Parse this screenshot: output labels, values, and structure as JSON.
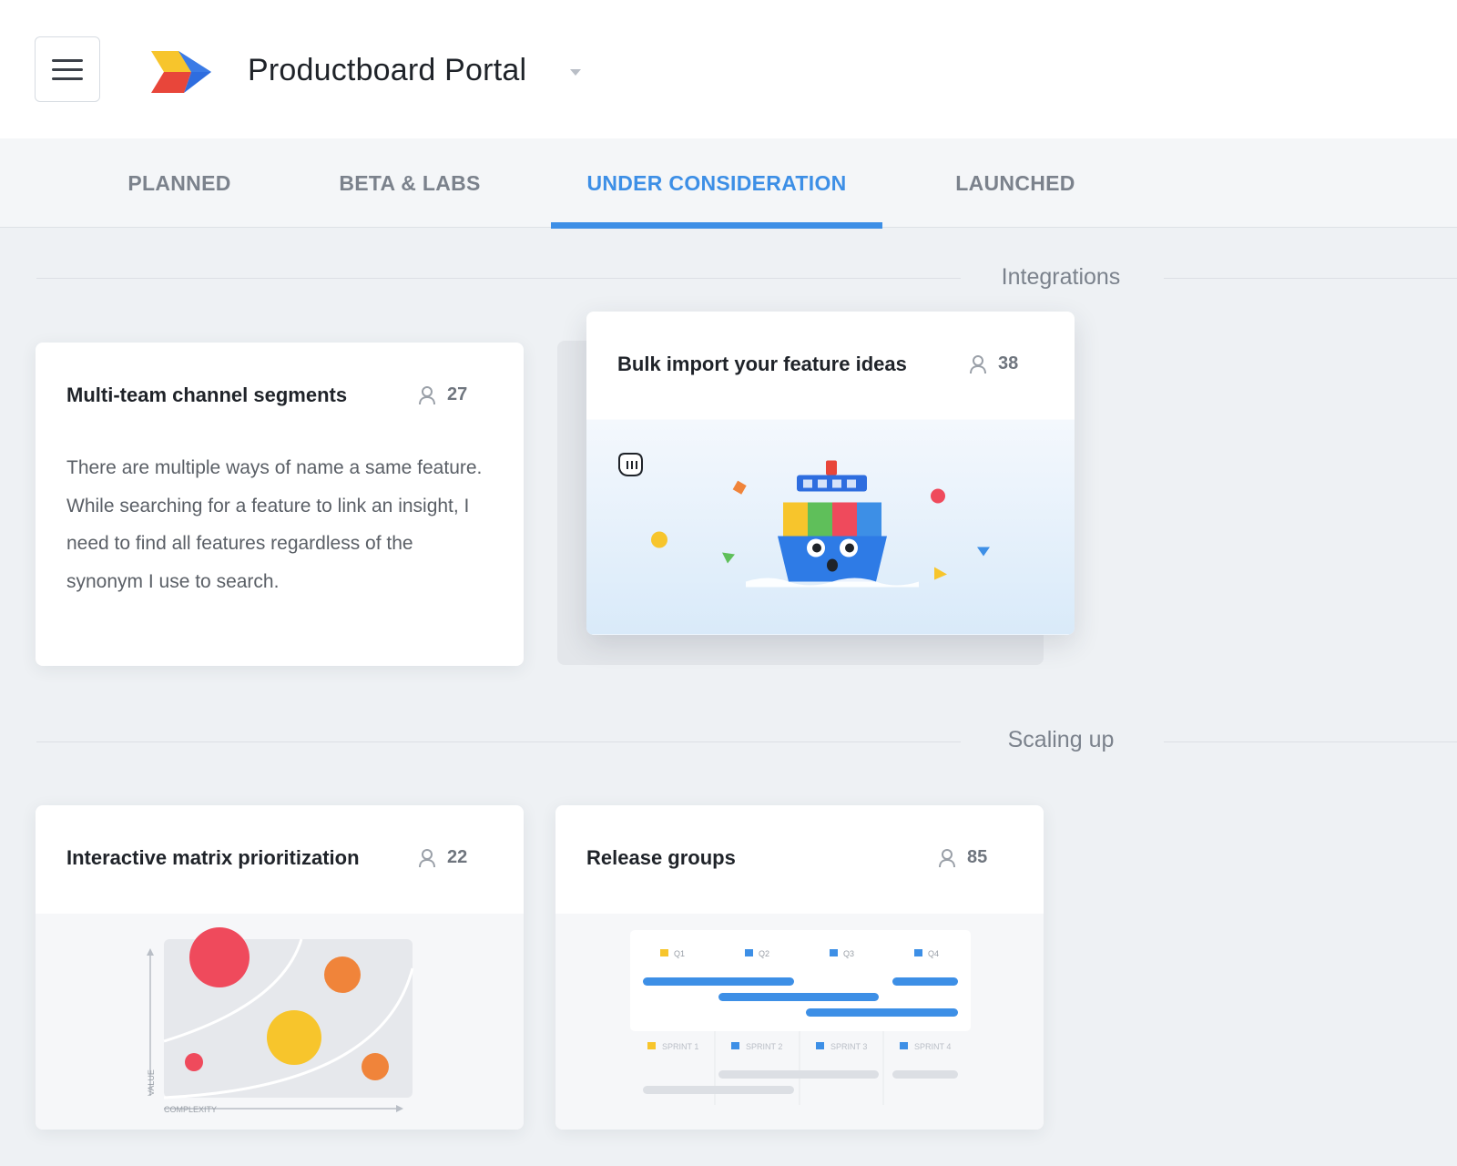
{
  "header": {
    "menu_icon": "hamburger-menu-icon",
    "logo_icon": "productboard-logo-icon",
    "portal_title": "Productboard Portal",
    "caret_icon": "caret-down-icon"
  },
  "tabs": [
    {
      "label": "PLANNED",
      "active": false
    },
    {
      "label": "BETA & LABS",
      "active": false
    },
    {
      "label": "UNDER CONSIDERATION",
      "active": true
    },
    {
      "label": "LAUNCHED",
      "active": false
    }
  ],
  "colors": {
    "accent": "#3d8fe6",
    "background": "#eef1f4",
    "card": "#ffffff"
  },
  "sections": [
    {
      "title": "Integrations",
      "cards": [
        {
          "title": "Multi-team channel segments",
          "votes": "27",
          "vote_icon": "user-icon",
          "description": "There are multiple ways of name a same feature. While searching for a feature to link an insight, I need to find all features regardless of the synonym I use to search."
        },
        {
          "title": "Bulk import your feature ideas",
          "votes": "38",
          "vote_icon": "user-icon",
          "illustration": "container-ship-illustration"
        }
      ]
    },
    {
      "title": "Scaling up",
      "cards": [
        {
          "title": "Interactive matrix prioritization",
          "votes": "22",
          "vote_icon": "user-icon",
          "illustration": {
            "type": "prioritization-matrix",
            "y_label": "VALUE",
            "x_label": "COMPLEXITY"
          }
        },
        {
          "title": "Release groups",
          "votes": "85",
          "vote_icon": "user-icon",
          "illustration": {
            "type": "release-roadmap",
            "quarters": [
              "Q1",
              "Q2",
              "Q3",
              "Q4"
            ],
            "sprints": [
              "SPRINT 1",
              "SPRINT 2",
              "SPRINT 3",
              "SPRINT 4"
            ]
          }
        }
      ]
    }
  ]
}
